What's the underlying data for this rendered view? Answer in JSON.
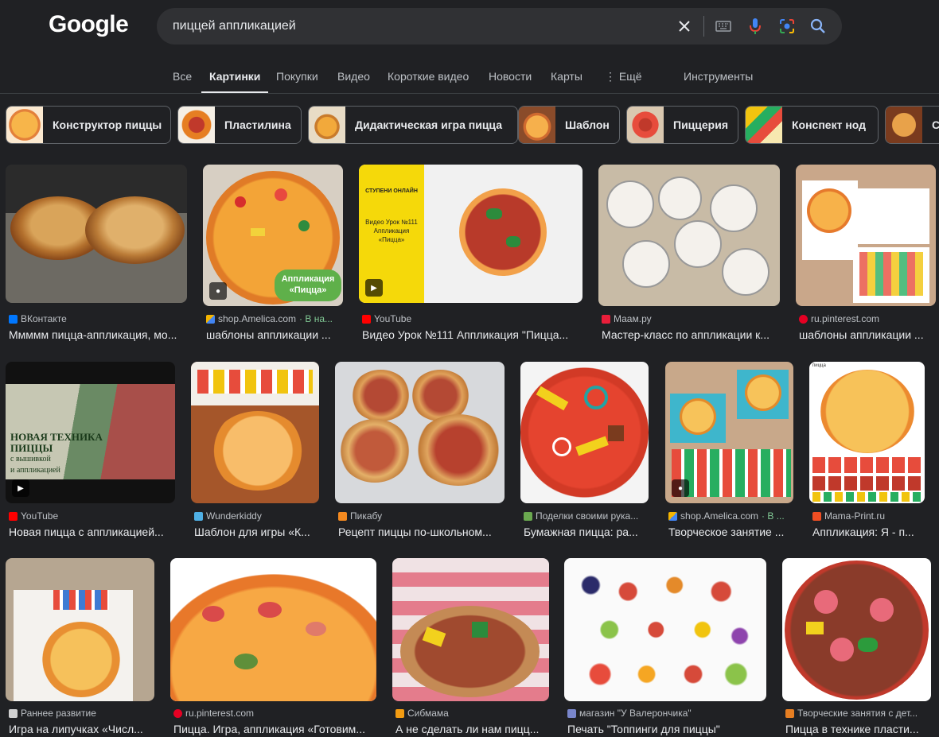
{
  "logo": "Google",
  "search": {
    "query": "пиццей аппликацией"
  },
  "nav": [
    "Все",
    "Картинки",
    "Покупки",
    "Видео",
    "Короткие видео",
    "Новости",
    "Карты",
    "⋮ Ещё",
    "Инструменты"
  ],
  "chips": [
    "Конструктор пиццы",
    "Пластилина",
    "Дидактическая игра пицца",
    "Шаблон",
    "Пиццерия",
    "Конспект нод",
    "С"
  ],
  "results": [
    {
      "source": "ВКонтакте",
      "title": "Ммммм пицца-аппликация, мо..."
    },
    {
      "source": "shop.Amelica.com",
      "extra": "· В на...",
      "title": "шаблоны аппликации ..."
    },
    {
      "source": "YouTube",
      "title": "Видео Урок №111 Аппликация \"Пицца..."
    },
    {
      "source": "Маам.ру",
      "title": "Мастер-класс по аппликации к..."
    },
    {
      "source": "ru.pinterest.com",
      "title": "шаблоны аппликации ..."
    },
    {
      "source": "YouTube",
      "title": "Новая пицца с аппликацией..."
    },
    {
      "source": "Wunderkiddy",
      "title": "Шаблон для игры «К..."
    },
    {
      "source": "Пикабу",
      "title": "Рецепт пиццы по-школьном..."
    },
    {
      "source": "Поделки своими рука...",
      "title": "Бумажная пицца: ра..."
    },
    {
      "source": "shop.Amelica.com",
      "extra": "· В ...",
      "title": "Творческое занятие ..."
    },
    {
      "source": "Mama-Print.ru",
      "title": "Аппликация: Я - п..."
    },
    {
      "source": "Раннее развитие",
      "title": "Игра на липучках «Числ..."
    },
    {
      "source": "ru.pinterest.com",
      "title": "Пицца. Игра, аппликация «Готовим..."
    },
    {
      "source": "Сибмама",
      "title": "А не сделать ли нам пицц..."
    },
    {
      "source": "магазин \"У Валерончика\"",
      "title": "Печать \"Топпинги для пиццы\""
    },
    {
      "source": "Творческие занятия с дет...",
      "title": "Пицца в технике пласти..."
    }
  ],
  "overlays": {
    "r1_caption": "Аппликация «Пицца»",
    "r2_brand": "СТУПЕНИ ОНЛАЙН",
    "r2_lesson": "Видео Урок №111 Аппликация «Пицца»",
    "r5_line1": "НОВАЯ ТЕХНИКА",
    "r5_line2": "ПИЦЦЫ",
    "r5_line3": "с вышивкой",
    "r5_line4": "и аппликацией",
    "r10_label": "пицца"
  },
  "colors": {
    "bg": "#202124",
    "search_bg": "#303134",
    "text": "#e8eaed",
    "muted": "#bdc1c6",
    "border": "#5f6368"
  }
}
